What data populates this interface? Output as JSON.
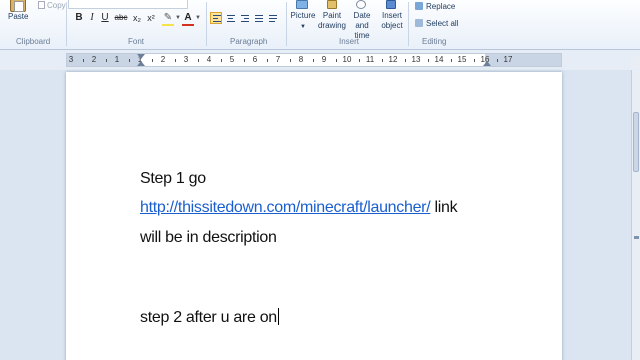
{
  "ribbon": {
    "clipboard": {
      "paste_label": "Paste",
      "copy_label": "Copy",
      "group_label": "Clipboard"
    },
    "font": {
      "bold": "B",
      "italic": "I",
      "underline": "U",
      "strike": "abc",
      "subscript": "x₂",
      "superscript": "x²",
      "highlight": "✎",
      "font_color": "A",
      "group_label": "Font"
    },
    "paragraph": {
      "group_label": "Paragraph"
    },
    "insert": {
      "picture_label": "Picture",
      "paint_label_1": "Paint",
      "paint_label_2": "drawing",
      "datetime_label_1": "Date and",
      "datetime_label_2": "time",
      "object_label_1": "Insert",
      "object_label_2": "object",
      "group_label": "Insert"
    },
    "editing": {
      "replace_label": "Replace",
      "select_all_label": "Select all",
      "group_label": "Editing"
    },
    "colors": {
      "highlight_bar": "#f5e34a",
      "font_color_bar": "#d33020"
    }
  },
  "ruler": {
    "labels": [
      "3",
      "2",
      "1",
      "1",
      "2",
      "3",
      "4",
      "5",
      "6",
      "7",
      "8",
      "9",
      "10",
      "11",
      "12",
      "13",
      "14",
      "15",
      "16",
      "17"
    ]
  },
  "document": {
    "line1": "Step 1 go",
    "link": "http://thissitedown.com/minecraft/launcher/",
    "line2_suffix": " link",
    "line3": "will be in description",
    "line4": "step 2 after u are on"
  }
}
